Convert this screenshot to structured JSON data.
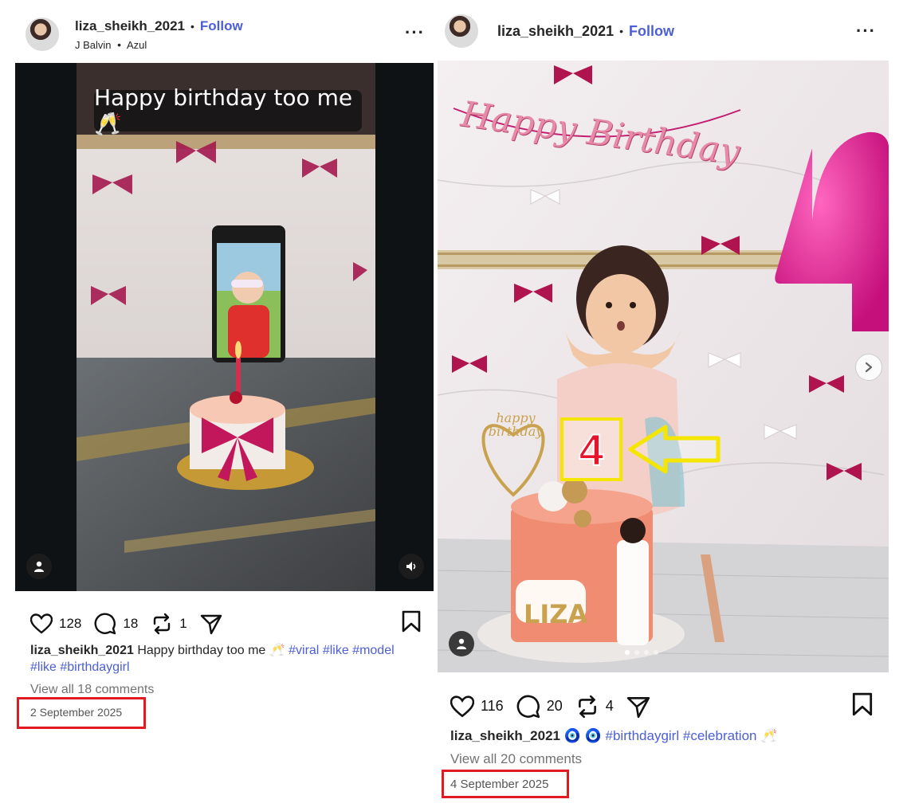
{
  "left": {
    "username": "liza_sheikh_2021",
    "follow": "Follow",
    "sep": "•",
    "music_artist": "J Balvin",
    "music_track": "Azul",
    "overlay_text": "Happy birthday too me 🥂",
    "likes": "128",
    "comments": "18",
    "reposts": "1",
    "caption_user": "liza_sheikh_2021",
    "caption_text": "Happy birthday too me 🥂",
    "hashtags": [
      "#viral",
      "#like",
      "#model",
      "#like",
      "#birthdaygirl"
    ],
    "view_all": "View all 18 comments",
    "date": "2 September 2025"
  },
  "right": {
    "username": "liza_sheikh_2021",
    "follow": "Follow",
    "sep": "•",
    "banner_text": "Happy Birthday",
    "cake_name": "LIZA",
    "topper_text": "happy birthday",
    "number": "4",
    "likes": "116",
    "comments": "20",
    "reposts": "4",
    "caption_user": "liza_sheikh_2021",
    "caption_emoji": "🧿 🧿",
    "hashtags": [
      "#birthdaygirl",
      "#celebration"
    ],
    "caption_tail": "🥂",
    "view_all": "View all 20 comments",
    "date": "4 September 2025"
  },
  "colors": {
    "link": "#4c5fd5",
    "highlight_red": "#e21a22",
    "highlight_yellow": "#f5e600",
    "balloon": "#e0138c"
  }
}
